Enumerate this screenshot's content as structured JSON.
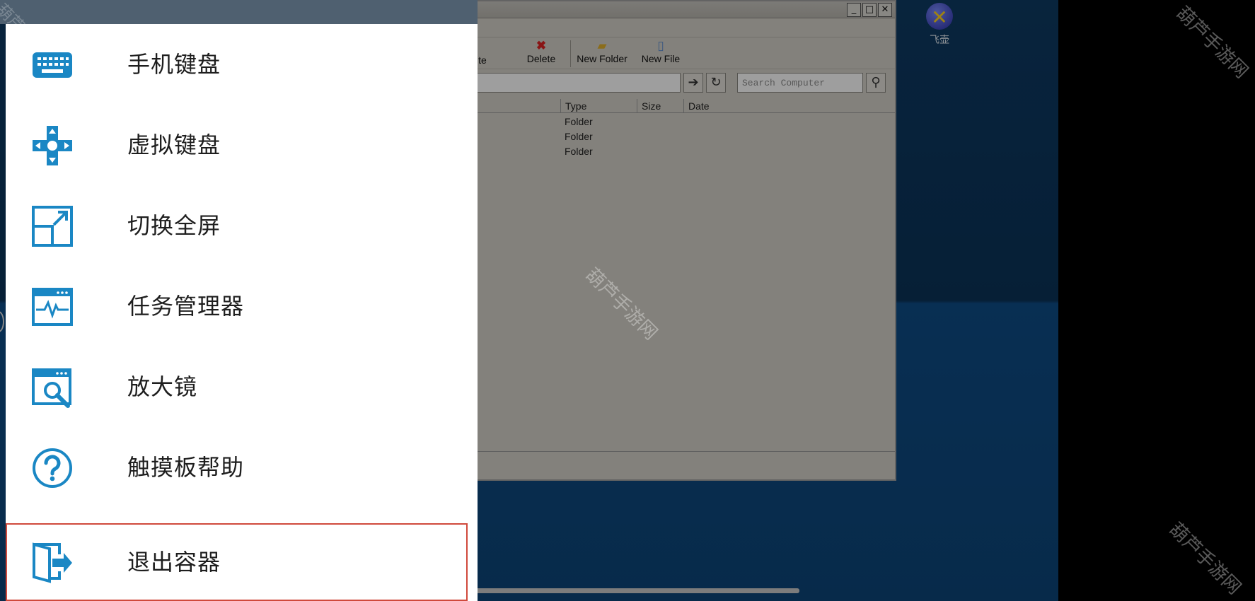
{
  "menu": {
    "items": [
      {
        "label": "手机键盘",
        "icon": "keyboard-icon"
      },
      {
        "label": "虚拟键盘",
        "icon": "dpad-icon"
      },
      {
        "label": "切换全屏",
        "icon": "fullscreen-icon"
      },
      {
        "label": "任务管理器",
        "icon": "task-manager-icon"
      },
      {
        "label": "放大镜",
        "icon": "magnifier-icon"
      },
      {
        "label": "触摸板帮助",
        "icon": "help-icon"
      },
      {
        "label": "退出容器",
        "icon": "exit-icon"
      }
    ],
    "selected_index": 6,
    "icon_color": "#1a87c4",
    "highlight_color": "#d0493c"
  },
  "desktop": {
    "icon_label": "飞壶"
  },
  "file_window": {
    "toolbar": {
      "partial_label": "te",
      "delete": "Delete",
      "new_folder": "New Folder",
      "new_file": "New File"
    },
    "search_placeholder": "Search Computer",
    "columns": {
      "type": "Type",
      "size": "Size",
      "date": "Date"
    },
    "rows": [
      {
        "type": "Folder"
      },
      {
        "type": "Folder"
      },
      {
        "type": "Folder"
      }
    ]
  },
  "watermark": "葫芦手游网",
  "watermark_partial": "葫芦"
}
